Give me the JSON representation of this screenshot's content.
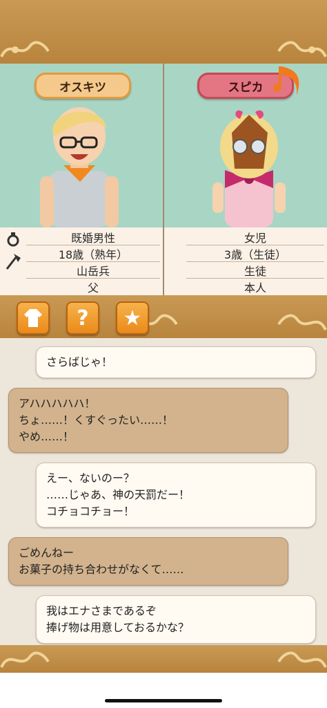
{
  "characters": {
    "left": {
      "name": "オスキツ",
      "info": [
        "既婚男性",
        "18歳（熟年）",
        "山岳兵",
        "父"
      ]
    },
    "right": {
      "name": "スピカ",
      "info": [
        "女児",
        "3歳（生徒）",
        "生徒",
        "本人"
      ]
    }
  },
  "icons": {
    "ring": "ring-icon",
    "axe": "axe-icon",
    "toolbar": [
      "outfit-icon",
      "question-icon",
      "star-icon"
    ]
  },
  "toolbar": {
    "question_label": "?",
    "star_label": "★"
  },
  "chat": [
    {
      "side": "right",
      "style": "white",
      "text": "さらばじゃ！"
    },
    {
      "side": "left",
      "style": "brown",
      "text": "アハハハハハ！\nちょ……！くすぐったい……！\nやめ……！"
    },
    {
      "side": "right",
      "style": "white",
      "text": "えー、ないのー？\n……じゃあ、神の天罰だー！\nコチョコチョー！"
    },
    {
      "side": "left",
      "style": "brown",
      "text": "ごめんねー\nお菓子の持ち合わせがなくて……"
    },
    {
      "side": "right",
      "style": "white",
      "text": "我はエナさまであるぞ\n捧げ物は用意しておるかな？"
    }
  ],
  "colors": {
    "wood": "#c99a55",
    "portrait_bg": "#a9d6c4",
    "name_left": "#f5c98c",
    "name_right": "#e37682",
    "button": "#f2a23a"
  }
}
